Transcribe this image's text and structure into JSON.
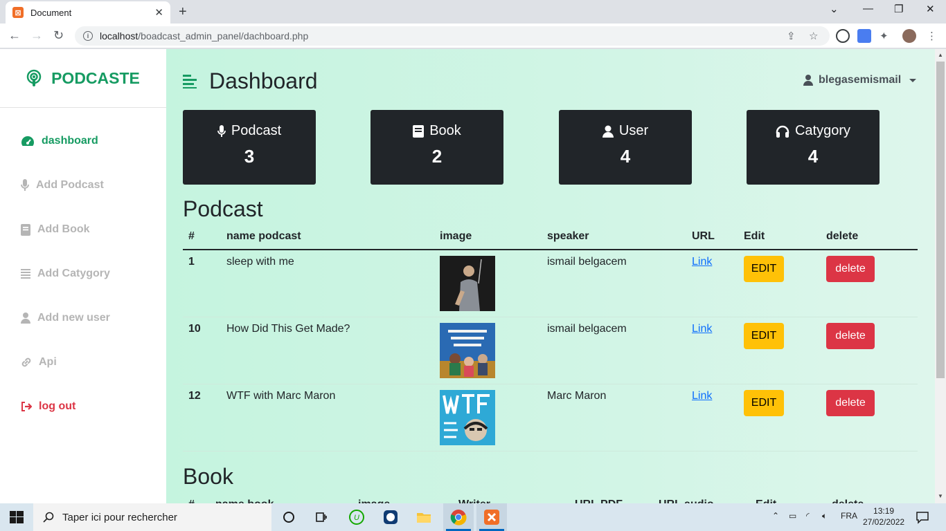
{
  "browser": {
    "tab_title": "Document",
    "tab_close": "✕",
    "new_tab": "+",
    "url_host": "localhost",
    "url_path": "/boadcast_admin_panel/dachboard.php"
  },
  "sidebar": {
    "brand": "PODCASTE",
    "items": [
      {
        "label": "dashboard",
        "icon": "gauge-icon"
      },
      {
        "label": "Add Podcast",
        "icon": "microphone-icon"
      },
      {
        "label": "Add Book",
        "icon": "book-icon"
      },
      {
        "label": "Add Catygory",
        "icon": "list-icon"
      },
      {
        "label": "Add new user",
        "icon": "user-icon"
      },
      {
        "label": "Api",
        "icon": "link-icon"
      },
      {
        "label": "log out",
        "icon": "sign-out-icon"
      }
    ]
  },
  "header": {
    "title": "Dashboard",
    "username": "blegasemismail"
  },
  "cards": [
    {
      "label": "Podcast",
      "value": "3",
      "icon": "microphone-icon"
    },
    {
      "label": "Book",
      "value": "2",
      "icon": "book-icon"
    },
    {
      "label": "User",
      "value": "4",
      "icon": "user-icon"
    },
    {
      "label": "Catygory",
      "value": "4",
      "icon": "headphones-icon"
    }
  ],
  "podcast_section": {
    "title": "Podcast",
    "columns": [
      "#",
      "name podcast",
      "image",
      "speaker",
      "URL",
      "Edit",
      "delete"
    ],
    "rows": [
      {
        "id": "1",
        "name": "sleep with me",
        "speaker": "ismail belgacem",
        "url": "Link",
        "edit": "EDIT",
        "delete": "delete"
      },
      {
        "id": "10",
        "name": "How Did This Get Made?",
        "speaker": "ismail belgacem",
        "url": "Link",
        "edit": "EDIT",
        "delete": "delete"
      },
      {
        "id": "12",
        "name": "WTF with Marc Maron",
        "speaker": "Marc Maron",
        "url": "Link",
        "edit": "EDIT",
        "delete": "delete"
      }
    ]
  },
  "book_section": {
    "title": "Book",
    "columns": [
      "#",
      "name book",
      "image",
      "Writer",
      "URL PDF",
      "URL audio",
      "Edit",
      "delete"
    ]
  },
  "taskbar": {
    "search_placeholder": "Taper ici pour rechercher",
    "language": "FRA",
    "time": "13:19",
    "date": "27/02/2022"
  },
  "colors": {
    "brand": "#169b62",
    "card": "#212529",
    "edit": "#ffc107",
    "delete": "#dc3545"
  }
}
